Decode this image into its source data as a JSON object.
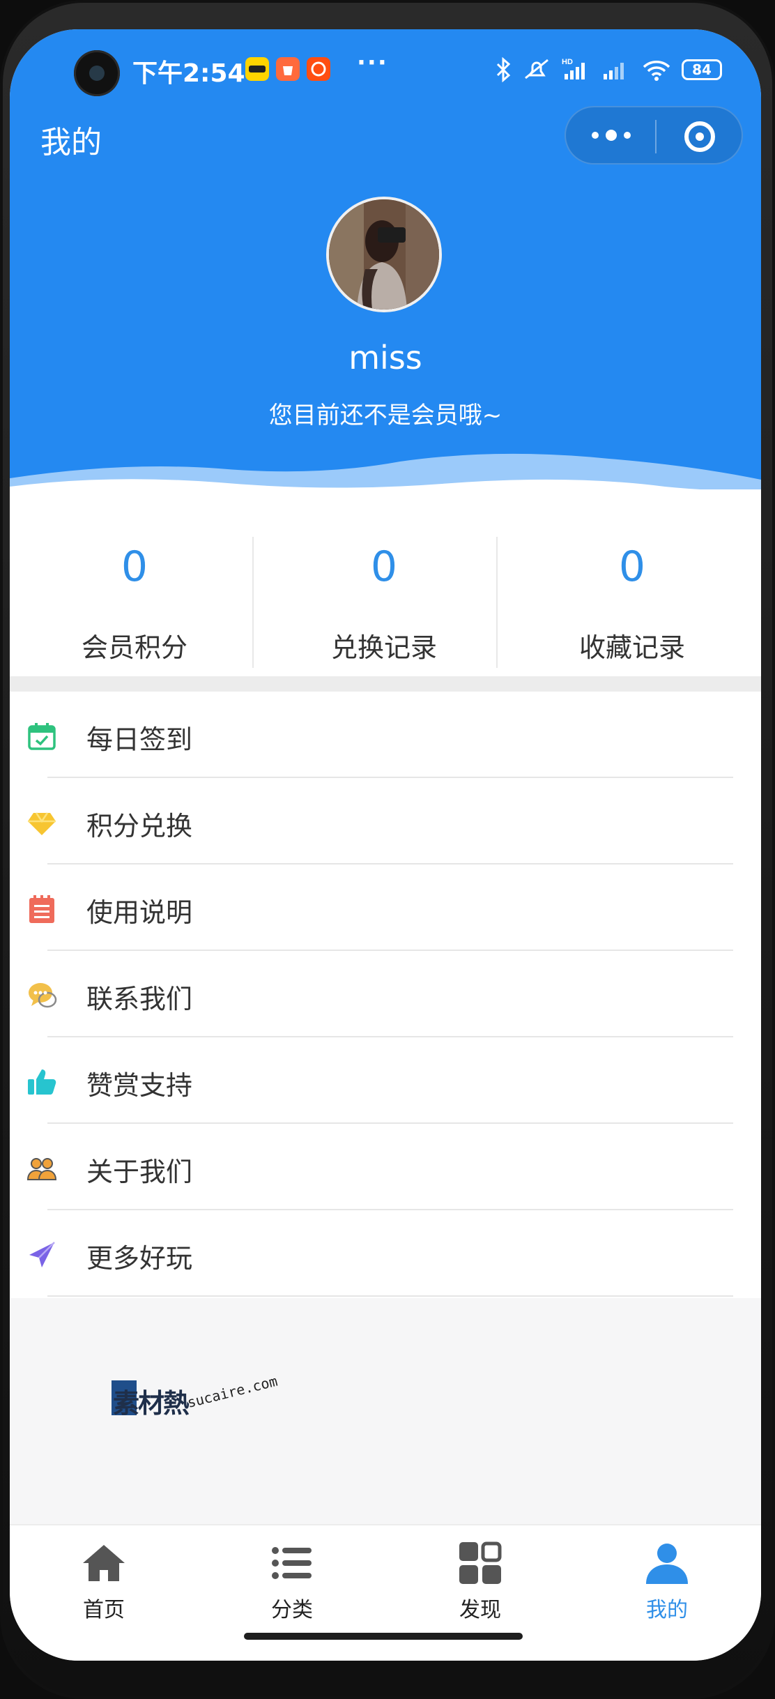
{
  "status_bar": {
    "time": "下午2:54",
    "app_icons": [
      "hungry-app-icon",
      "shopping-bag-app-icon",
      "taobao-app-icon"
    ],
    "more": "···",
    "battery": "84",
    "indicators": [
      "bluetooth-icon",
      "mute-icon",
      "hd-signal-icon",
      "signal-icon",
      "wifi-icon"
    ]
  },
  "header": {
    "title": "我的",
    "capsule": {
      "more_icon": "more-dots-icon",
      "close_icon": "target-circle-icon"
    },
    "bg_color": "#2489f1"
  },
  "profile": {
    "username": "miss",
    "membership_status": "您目前还不是会员哦~"
  },
  "stats": [
    {
      "value": "0",
      "label": "会员积分"
    },
    {
      "value": "0",
      "label": "兑换记录"
    },
    {
      "value": "0",
      "label": "收藏记录"
    }
  ],
  "menu": [
    {
      "label": "每日签到",
      "icon": "calendar-check-icon",
      "color": "#2ec27e"
    },
    {
      "label": "积分兑换",
      "icon": "diamond-icon",
      "color": "#f7c531"
    },
    {
      "label": "使用说明",
      "icon": "notepad-icon",
      "color": "#ef6b5b"
    },
    {
      "label": "联系我们",
      "icon": "chat-bubble-icon",
      "color": "#f2c04a"
    },
    {
      "label": "赞赏支持",
      "icon": "thumbs-up-icon",
      "color": "#27c4cf"
    },
    {
      "label": "关于我们",
      "icon": "team-icon",
      "color": "#f0a23a"
    },
    {
      "label": "更多好玩",
      "icon": "paper-plane-icon",
      "color": "#7a63e6"
    }
  ],
  "watermark": {
    "cn": "素材熱",
    "en": "sucaire.com"
  },
  "tabbar": {
    "active_index": 3,
    "active_color": "#2f8fe8",
    "tabs": [
      {
        "label": "首页",
        "icon": "home-icon"
      },
      {
        "label": "分类",
        "icon": "list-icon"
      },
      {
        "label": "发现",
        "icon": "grid-icon"
      },
      {
        "label": "我的",
        "icon": "user-icon"
      }
    ]
  }
}
